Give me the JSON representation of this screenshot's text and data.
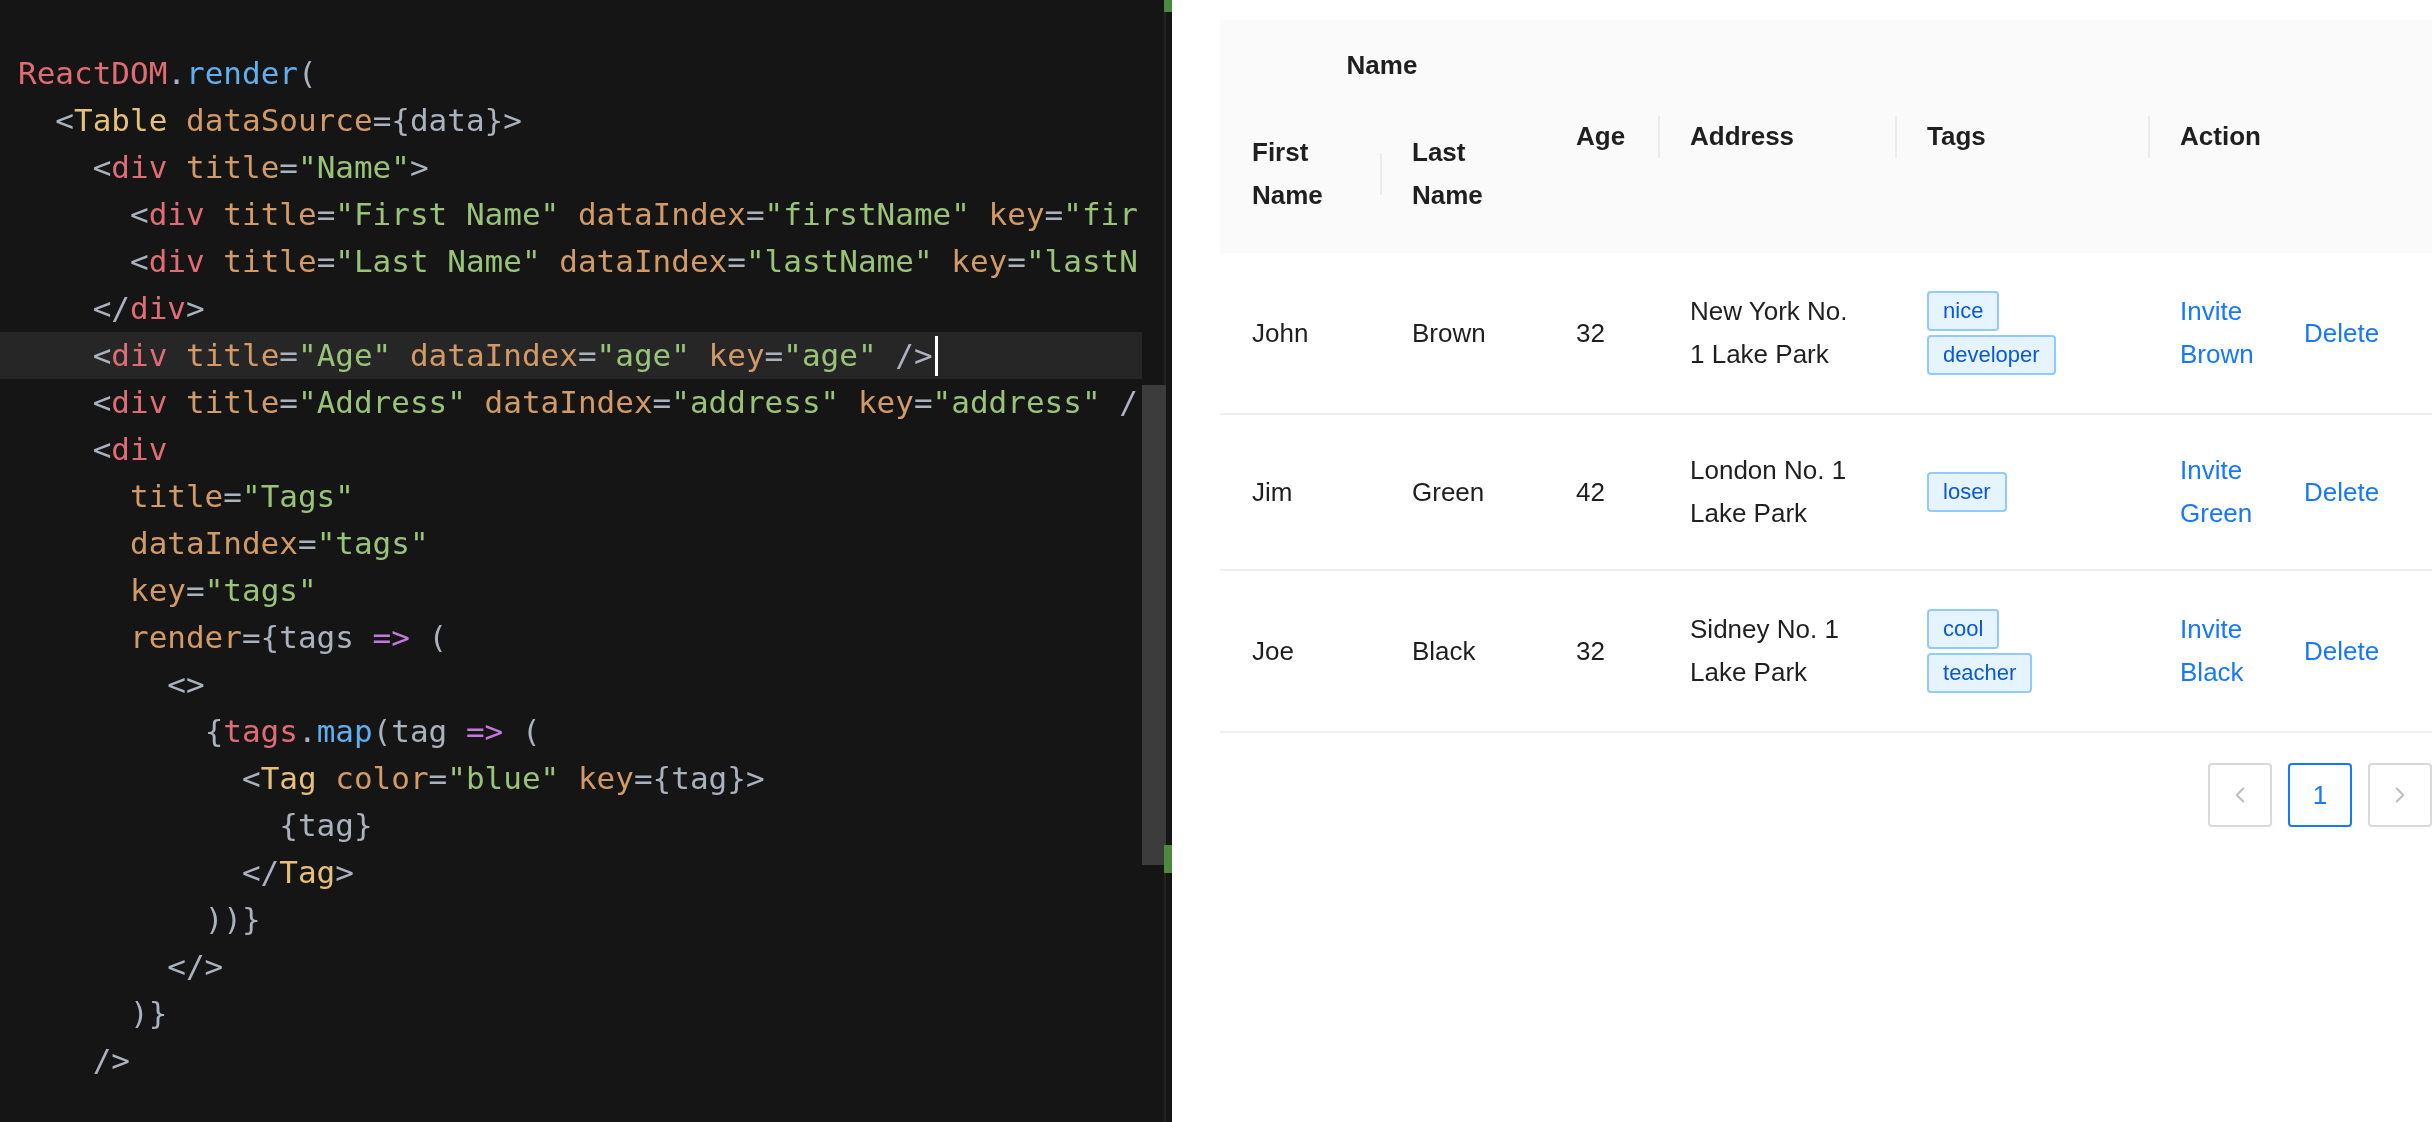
{
  "editor": {
    "lines": [
      {
        "active": false,
        "tokens": [
          {
            "kind": "object",
            "text": "ReactDOM"
          },
          {
            "kind": "punct",
            "text": "."
          },
          {
            "kind": "method",
            "text": "render"
          },
          {
            "kind": "punct",
            "text": "("
          }
        ],
        "children": [
          {
            "active": false,
            "tokens": [
              {
                "kind": "punct",
                "text": "<"
              },
              {
                "kind": "component",
                "text": "Table"
              },
              {
                "kind": "attr",
                "text": " dataSource"
              },
              {
                "kind": "punct",
                "text": "={data}>"
              }
            ],
            "children": [
              {
                "active": false,
                "tokens": [
                  {
                    "kind": "punct",
                    "text": "<"
                  },
                  {
                    "kind": "tag",
                    "text": "div"
                  },
                  {
                    "kind": "attr",
                    "text": " title"
                  },
                  {
                    "kind": "punct",
                    "text": "="
                  },
                  {
                    "kind": "string",
                    "text": "\"Name\""
                  },
                  {
                    "kind": "punct",
                    "text": ">"
                  }
                ],
                "children": [
                  {
                    "active": false,
                    "tokens": [
                      {
                        "kind": "punct",
                        "text": "<"
                      },
                      {
                        "kind": "tag",
                        "text": "div"
                      },
                      {
                        "kind": "attr",
                        "text": " title"
                      },
                      {
                        "kind": "punct",
                        "text": "="
                      },
                      {
                        "kind": "string",
                        "text": "\"First Name\""
                      },
                      {
                        "kind": "attr",
                        "text": " dataIndex"
                      },
                      {
                        "kind": "punct",
                        "text": "="
                      },
                      {
                        "kind": "string",
                        "text": "\"firstName\""
                      },
                      {
                        "kind": "attr",
                        "text": " key"
                      },
                      {
                        "kind": "punct",
                        "text": "="
                      },
                      {
                        "kind": "string",
                        "text": "\"fir"
                      }
                    ]
                  },
                  {
                    "active": false,
                    "tokens": [
                      {
                        "kind": "punct",
                        "text": "<"
                      },
                      {
                        "kind": "tag",
                        "text": "div"
                      },
                      {
                        "kind": "attr",
                        "text": " title"
                      },
                      {
                        "kind": "punct",
                        "text": "="
                      },
                      {
                        "kind": "string",
                        "text": "\"Last Name\""
                      },
                      {
                        "kind": "attr",
                        "text": " dataIndex"
                      },
                      {
                        "kind": "punct",
                        "text": "="
                      },
                      {
                        "kind": "string",
                        "text": "\"lastName\""
                      },
                      {
                        "kind": "attr",
                        "text": " key"
                      },
                      {
                        "kind": "punct",
                        "text": "="
                      },
                      {
                        "kind": "string",
                        "text": "\"lastN"
                      }
                    ]
                  }
                ]
              },
              {
                "active": false,
                "tokens": [
                  {
                    "kind": "punct",
                    "text": "</"
                  },
                  {
                    "kind": "tag",
                    "text": "div"
                  },
                  {
                    "kind": "punct",
                    "text": ">"
                  }
                ]
              },
              {
                "active": true,
                "tokens": [
                  {
                    "kind": "punct",
                    "text": "<"
                  },
                  {
                    "kind": "tag",
                    "text": "div"
                  },
                  {
                    "kind": "attr",
                    "text": " title"
                  },
                  {
                    "kind": "punct",
                    "text": "="
                  },
                  {
                    "kind": "string",
                    "text": "\"Age\""
                  },
                  {
                    "kind": "attr",
                    "text": " dataIndex"
                  },
                  {
                    "kind": "punct",
                    "text": "="
                  },
                  {
                    "kind": "string",
                    "text": "\"age\""
                  },
                  {
                    "kind": "attr",
                    "text": " key"
                  },
                  {
                    "kind": "punct",
                    "text": "="
                  },
                  {
                    "kind": "string",
                    "text": "\"age\""
                  },
                  {
                    "kind": "punct",
                    "text": " />"
                  }
                ]
              },
              {
                "active": false,
                "tokens": [
                  {
                    "kind": "punct",
                    "text": "<"
                  },
                  {
                    "kind": "tag",
                    "text": "div"
                  },
                  {
                    "kind": "attr",
                    "text": " title"
                  },
                  {
                    "kind": "punct",
                    "text": "="
                  },
                  {
                    "kind": "string",
                    "text": "\"Address\""
                  },
                  {
                    "kind": "attr",
                    "text": " dataIndex"
                  },
                  {
                    "kind": "punct",
                    "text": "="
                  },
                  {
                    "kind": "string",
                    "text": "\"address\""
                  },
                  {
                    "kind": "attr",
                    "text": " key"
                  },
                  {
                    "kind": "punct",
                    "text": "="
                  },
                  {
                    "kind": "string",
                    "text": "\"address\""
                  },
                  {
                    "kind": "punct",
                    "text": " /"
                  }
                ]
              },
              {
                "active": false,
                "tokens": [
                  {
                    "kind": "punct",
                    "text": "<"
                  },
                  {
                    "kind": "tag",
                    "text": "div"
                  }
                ],
                "children": [
                  {
                    "active": false,
                    "tokens": [
                      {
                        "kind": "attr",
                        "text": "title"
                      },
                      {
                        "kind": "punct",
                        "text": "="
                      },
                      {
                        "kind": "string",
                        "text": "\"Tags\""
                      }
                    ]
                  },
                  {
                    "active": false,
                    "tokens": [
                      {
                        "kind": "attr",
                        "text": "dataIndex"
                      },
                      {
                        "kind": "punct",
                        "text": "="
                      },
                      {
                        "kind": "string",
                        "text": "\"tags\""
                      }
                    ]
                  },
                  {
                    "active": false,
                    "tokens": [
                      {
                        "kind": "attr",
                        "text": "key"
                      },
                      {
                        "kind": "punct",
                        "text": "="
                      },
                      {
                        "kind": "string",
                        "text": "\"tags\""
                      }
                    ]
                  },
                  {
                    "active": false,
                    "tokens": [
                      {
                        "kind": "attr",
                        "text": "render"
                      },
                      {
                        "kind": "punct",
                        "text": "={tags "
                      },
                      {
                        "kind": "keyword",
                        "text": "=>"
                      },
                      {
                        "kind": "punct",
                        "text": " ("
                      }
                    ],
                    "children": [
                      {
                        "active": false,
                        "tokens": [
                          {
                            "kind": "punct",
                            "text": "<>"
                          }
                        ],
                        "children": [
                          {
                            "active": false,
                            "tokens": [
                              {
                                "kind": "punct",
                                "text": "{"
                              },
                              {
                                "kind": "object",
                                "text": "tags"
                              },
                              {
                                "kind": "punct",
                                "text": "."
                              },
                              {
                                "kind": "method",
                                "text": "map"
                              },
                              {
                                "kind": "punct",
                                "text": "(tag "
                              },
                              {
                                "kind": "keyword",
                                "text": "=>"
                              },
                              {
                                "kind": "punct",
                                "text": " ("
                              }
                            ],
                            "children": [
                              {
                                "active": false,
                                "tokens": [
                                  {
                                    "kind": "punct",
                                    "text": "<"
                                  },
                                  {
                                    "kind": "component",
                                    "text": "Tag"
                                  },
                                  {
                                    "kind": "attr",
                                    "text": " color"
                                  },
                                  {
                                    "kind": "punct",
                                    "text": "="
                                  },
                                  {
                                    "kind": "string",
                                    "text": "\"blue\""
                                  },
                                  {
                                    "kind": "attr",
                                    "text": " key"
                                  },
                                  {
                                    "kind": "punct",
                                    "text": "={tag}>"
                                  }
                                ],
                                "children": [
                                  {
                                    "active": false,
                                    "tokens": [
                                      {
                                        "kind": "punct",
                                        "text": "{tag}"
                                      }
                                    ]
                                  }
                                ]
                              },
                              {
                                "active": false,
                                "tokens": [
                                  {
                                    "kind": "punct",
                                    "text": "</"
                                  },
                                  {
                                    "kind": "component",
                                    "text": "Tag"
                                  },
                                  {
                                    "kind": "punct",
                                    "text": ">"
                                  }
                                ]
                              }
                            ]
                          },
                          {
                            "active": false,
                            "tokens": [
                              {
                                "kind": "punct",
                                "text": "))}"
                              }
                            ]
                          }
                        ]
                      },
                      {
                        "active": false,
                        "tokens": [
                          {
                            "kind": "punct",
                            "text": "</>"
                          }
                        ]
                      }
                    ]
                  },
                  {
                    "active": false,
                    "tokens": [
                      {
                        "kind": "punct",
                        "text": ")}"
                      }
                    ]
                  }
                ]
              },
              {
                "active": false,
                "tokens": [
                  {
                    "kind": "punct",
                    "text": "/>"
                  }
                ]
              }
            ]
          }
        ]
      }
    ]
  },
  "table": {
    "group_header": "Name",
    "sub_headers": [
      "First Name",
      "Last Name"
    ],
    "headers": [
      "Age",
      "Address",
      "Tags",
      "Action"
    ],
    "rows": [
      {
        "first_name": "John",
        "last_name": "Brown",
        "age": "32",
        "address": "New York No. 1 Lake Park",
        "tags": [
          "nice",
          "developer"
        ],
        "invite": "Invite Brown",
        "delete": "Delete"
      },
      {
        "first_name": "Jim",
        "last_name": "Green",
        "age": "42",
        "address": "London No. 1 Lake Park",
        "tags": [
          "loser"
        ],
        "invite": "Invite Green",
        "delete": "Delete"
      },
      {
        "first_name": "Joe",
        "last_name": "Black",
        "age": "32",
        "address": "Sidney No. 1 Lake Park",
        "tags": [
          "cool",
          "teacher"
        ],
        "invite": "Invite Black",
        "delete": "Delete"
      }
    ]
  },
  "pagination": {
    "prev": {
      "disabled": true
    },
    "pages": [
      {
        "label": "1",
        "selected": true
      }
    ],
    "next": {
      "disabled": true
    }
  }
}
